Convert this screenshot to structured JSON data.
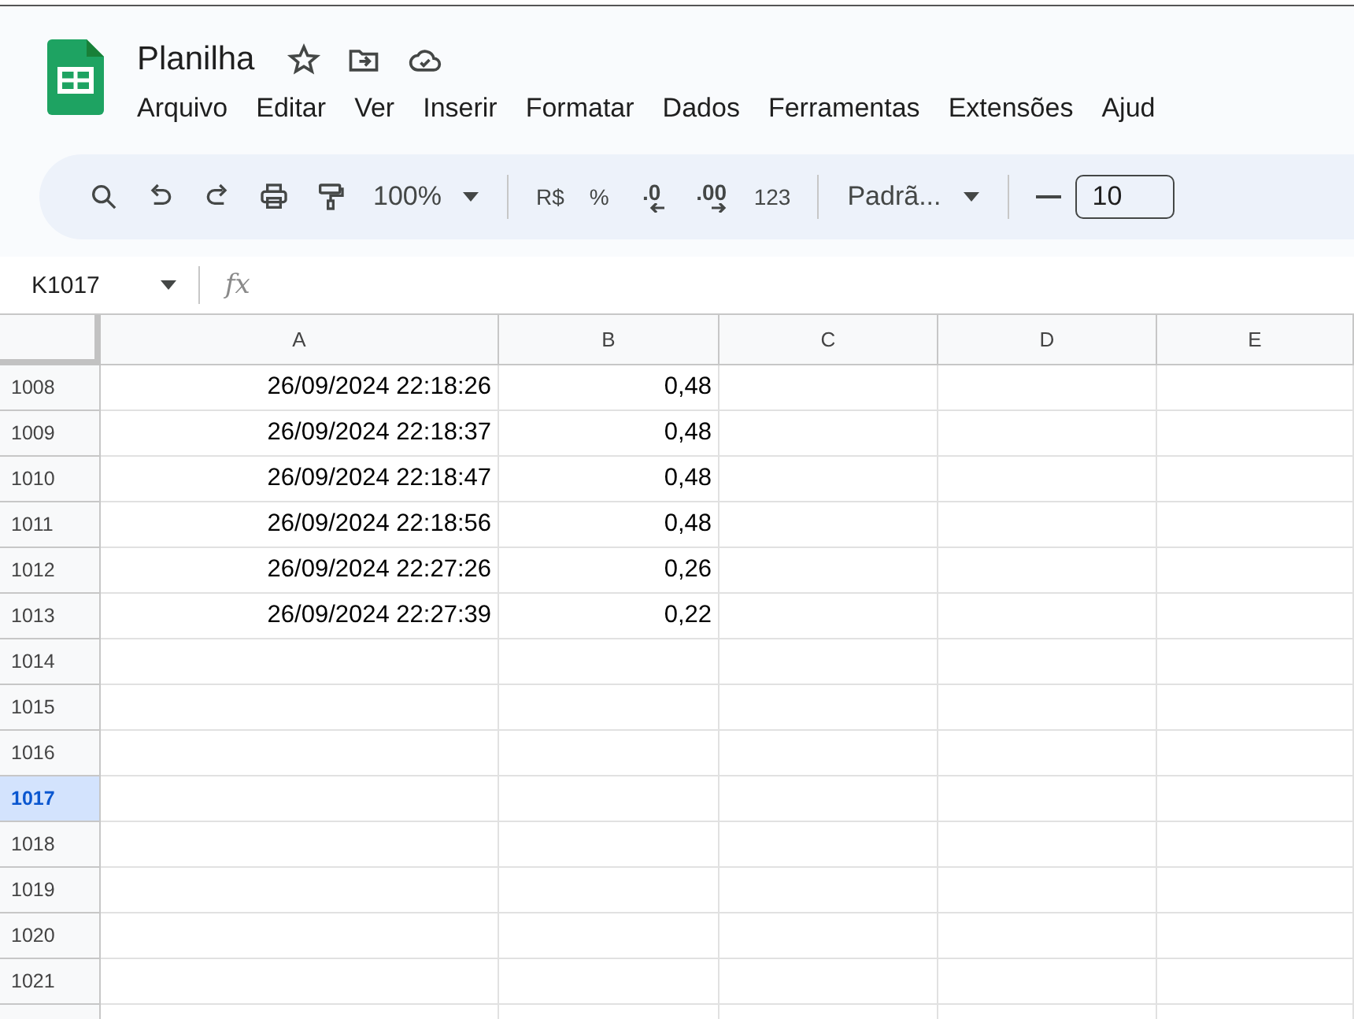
{
  "document": {
    "title": "Planilha"
  },
  "menu": [
    "Arquivo",
    "Editar",
    "Ver",
    "Inserir",
    "Formatar",
    "Dados",
    "Ferramentas",
    "Extensões",
    "Ajud"
  ],
  "toolbar": [
    {
      "kind": "search"
    },
    {
      "kind": "undo"
    },
    {
      "kind": "redo"
    },
    {
      "kind": "print"
    },
    {
      "kind": "paint-format"
    },
    {
      "kind": "dropdown",
      "label": "100%"
    },
    {
      "kind": "separator"
    },
    {
      "kind": "text",
      "label": "R$"
    },
    {
      "kind": "text",
      "label": "%"
    },
    {
      "kind": "decimal-decrease",
      "label": ".0"
    },
    {
      "kind": "decimal-increase",
      "label": ".00"
    },
    {
      "kind": "text",
      "label": "123"
    },
    {
      "kind": "separator"
    },
    {
      "kind": "dropdown",
      "label": "Padrã..."
    },
    {
      "kind": "separator"
    },
    {
      "kind": "minus"
    },
    {
      "kind": "field",
      "label": "10"
    }
  ],
  "name_box": "K1017",
  "formula_label": "fx",
  "columns": [
    "A",
    "B",
    "C",
    "D",
    "E"
  ],
  "rows": [
    {
      "number": "1008",
      "selected": false,
      "cells": [
        "26/09/2024 22:18:26",
        "0,48"
      ]
    },
    {
      "number": "1009",
      "selected": false,
      "cells": [
        "26/09/2024 22:18:37",
        "0,48"
      ]
    },
    {
      "number": "1010",
      "selected": false,
      "cells": [
        "26/09/2024 22:18:47",
        "0,48"
      ]
    },
    {
      "number": "1011",
      "selected": false,
      "cells": [
        "26/09/2024 22:18:56",
        "0,48"
      ]
    },
    {
      "number": "1012",
      "selected": false,
      "cells": [
        "26/09/2024 22:27:26",
        "0,26"
      ]
    },
    {
      "number": "1013",
      "selected": false,
      "cells": [
        "26/09/2024 22:27:39",
        "0,22"
      ]
    },
    {
      "number": "1014",
      "selected": false,
      "cells": []
    },
    {
      "number": "1015",
      "selected": false,
      "cells": []
    },
    {
      "number": "1016",
      "selected": false,
      "cells": []
    },
    {
      "number": "1017",
      "selected": true,
      "cells": []
    },
    {
      "number": "1018",
      "selected": false,
      "cells": []
    },
    {
      "number": "1019",
      "selected": false,
      "cells": []
    },
    {
      "number": "1020",
      "selected": false,
      "cells": []
    },
    {
      "number": "1021",
      "selected": false,
      "cells": []
    }
  ]
}
